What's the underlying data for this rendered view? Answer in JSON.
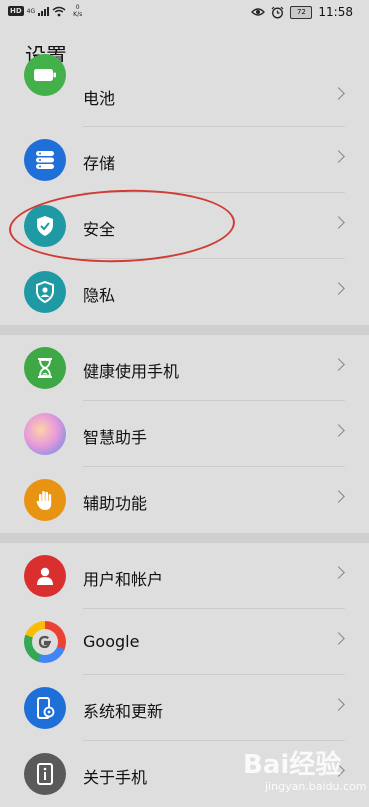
{
  "status_bar": {
    "hd_badge": "HD",
    "network_type": "4G",
    "speed_value": "0",
    "speed_unit": "K/s",
    "battery_level": "72",
    "time": "11:58",
    "icons": [
      "sim-signal-icon",
      "wifi-icon",
      "eye-icon",
      "alarm-icon",
      "battery-icon"
    ]
  },
  "page_title": "设置",
  "sections": [
    {
      "items": [
        {
          "label": "电池",
          "icon": "battery-icon",
          "color": "#43b04a"
        },
        {
          "label": "存储",
          "icon": "storage-icon",
          "color": "#1f6fd8"
        },
        {
          "label": "安全",
          "icon": "shield-check-icon",
          "color": "#1f9aa4"
        },
        {
          "label": "隐私",
          "icon": "privacy-shield-icon",
          "color": "#1f9aa4"
        }
      ]
    },
    {
      "items": [
        {
          "label": "健康使用手机",
          "icon": "hourglass-icon",
          "color": "#3ea846"
        },
        {
          "label": "智慧助手",
          "icon": "assistant-icon",
          "color": "#d27fd0"
        },
        {
          "label": "辅助功能",
          "icon": "hand-icon",
          "color": "#e99312"
        }
      ]
    },
    {
      "items": [
        {
          "label": "用户和帐户",
          "icon": "user-icon",
          "color": "#d9302f"
        },
        {
          "label": "Google",
          "icon": "google-icon",
          "color": "#4285f4"
        },
        {
          "label": "系统和更新",
          "icon": "system-update-icon",
          "color": "#1f6fd8"
        },
        {
          "label": "关于手机",
          "icon": "info-icon",
          "color": "#5a5a5a"
        }
      ]
    }
  ],
  "annotation_color": "#d23b33",
  "watermark": {
    "text": "Bai经验",
    "sub": "jingyan.baidu.com"
  }
}
